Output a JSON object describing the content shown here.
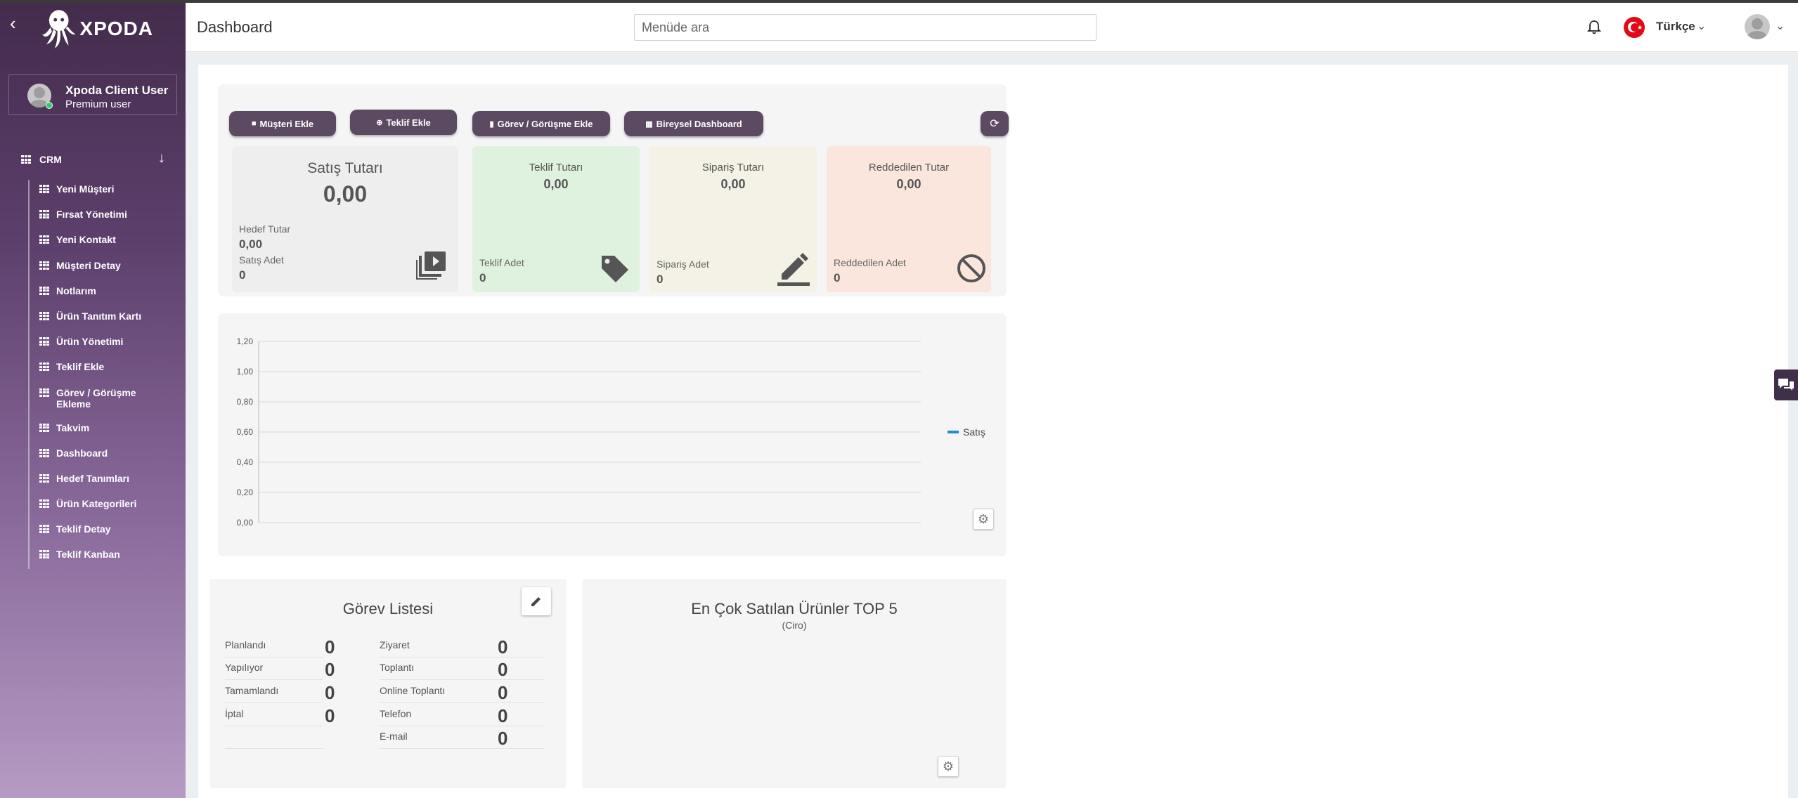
{
  "app": {
    "brand": "XPODA"
  },
  "sidebar": {
    "user": {
      "name": "Xpoda Client User",
      "role": "Premium user"
    },
    "section": "CRM",
    "items": [
      {
        "label": "Yeni Müşteri"
      },
      {
        "label": "Fırsat Yönetimi"
      },
      {
        "label": "Yeni Kontakt"
      },
      {
        "label": "Müşteri Detay"
      },
      {
        "label": "Notlarım"
      },
      {
        "label": "Ürün Tanıtım Kartı"
      },
      {
        "label": "Ürün Yönetimi"
      },
      {
        "label": "Teklif Ekle"
      },
      {
        "label": "Görev / Görüşme Ekleme"
      },
      {
        "label": "Takvim"
      },
      {
        "label": "Dashboard"
      },
      {
        "label": "Hedef Tanımları"
      },
      {
        "label": "Ürün Kategorileri"
      },
      {
        "label": "Teklif Detay"
      },
      {
        "label": "Teklif Kanban"
      }
    ]
  },
  "header": {
    "title": "Dashboard",
    "search_placeholder": "Menüde ara",
    "language": "Türkçe"
  },
  "toolbar": {
    "add_customer": "Müşteri Ekle",
    "add_offer": "Teklif Ekle",
    "add_task": "Görev / Görüşme Ekle",
    "personal_dashboard": "Bireysel Dashboard"
  },
  "cards": {
    "sales": {
      "title": "Satış Tutarı",
      "value": "0,00",
      "target_label": "Hedef Tutar",
      "target_value": "0,00",
      "count_label": "Satış Adet",
      "count_value": "0",
      "color": "#eeeeee"
    },
    "offer": {
      "title": "Teklif Tutarı",
      "value": "0,00",
      "count_label": "Teklif Adet",
      "count_value": "0",
      "color": "#dff1df"
    },
    "order": {
      "title": "Sipariş Tutarı",
      "value": "0,00",
      "count_label": "Sipariş Adet",
      "count_value": "0",
      "color": "#f4f2e6"
    },
    "rejected": {
      "title": "Reddedilen Tutar",
      "value": "0,00",
      "count_label": "Reddedilen Adet",
      "count_value": "0",
      "color": "#fae6dc"
    }
  },
  "chart_data": {
    "type": "line",
    "title": "",
    "xlabel": "",
    "ylabel": "",
    "ylim": [
      0,
      1.2
    ],
    "yticks": [
      "0,00",
      "0,20",
      "0,40",
      "0,60",
      "0,80",
      "1,00",
      "1,20"
    ],
    "series": [
      {
        "name": "Satış",
        "values": [],
        "color": "#1f8fcf"
      }
    ],
    "legend": "right",
    "grid": true
  },
  "tasks": {
    "title": "Görev Listesi",
    "status": [
      {
        "label": "Planlandı",
        "value": "0"
      },
      {
        "label": "Yapılıyor",
        "value": "0"
      },
      {
        "label": "Tamamlandı",
        "value": "0"
      },
      {
        "label": "İptal",
        "value": "0"
      }
    ],
    "types": [
      {
        "label": "Ziyaret",
        "value": "0"
      },
      {
        "label": "Toplantı",
        "value": "0"
      },
      {
        "label": "Online Toplantı",
        "value": "0"
      },
      {
        "label": "Telefon",
        "value": "0"
      },
      {
        "label": "E-mail",
        "value": "0"
      }
    ]
  },
  "top5": {
    "title": "En Çok Satılan Ürünler TOP 5",
    "subtitle": "(Ciro)"
  }
}
